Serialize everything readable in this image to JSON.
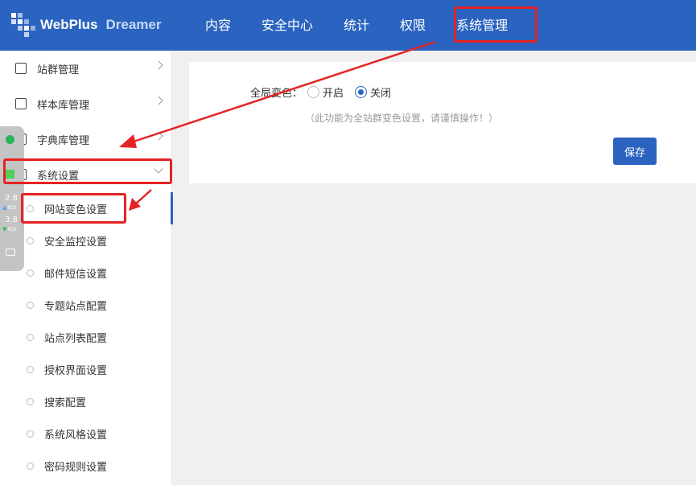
{
  "app": {
    "logo_primary": "WebPlus",
    "logo_secondary": "Dreamer"
  },
  "nav": [
    {
      "label": "内容"
    },
    {
      "label": "安全中心"
    },
    {
      "label": "统计"
    },
    {
      "label": "权限"
    },
    {
      "label": "系统管理",
      "active": true
    }
  ],
  "sidebar": {
    "groups": [
      {
        "label": "站群管理",
        "icon": "site-group-icon"
      },
      {
        "label": "样本库管理",
        "icon": "sample-library-icon"
      },
      {
        "label": "字典库管理",
        "icon": "dictionary-icon"
      },
      {
        "label": "系统设置",
        "icon": "system-settings-icon",
        "expanded": true
      }
    ],
    "sub_items": [
      {
        "label": "网站变色设置",
        "active": true
      },
      {
        "label": "安全监控设置"
      },
      {
        "label": "邮件短信设置"
      },
      {
        "label": "专题站点配置"
      },
      {
        "label": "站点列表配置"
      },
      {
        "label": "授权界面设置"
      },
      {
        "label": "搜索配置"
      },
      {
        "label": "系统风格设置"
      },
      {
        "label": "密码规则设置"
      }
    ]
  },
  "widget": {
    "upload": "2.8",
    "download": "3.8",
    "unit": "K/s"
  },
  "content": {
    "field_label": "全局变色：",
    "option_on": "开启",
    "option_off": "关闭",
    "selected": "关闭",
    "hint": "（此功能为全站群变色设置，请谨慎操作！）",
    "save_label": "保存"
  },
  "colors": {
    "header": "#2a64c0",
    "accent": "#2a64c0",
    "annotation": "#e62323"
  }
}
